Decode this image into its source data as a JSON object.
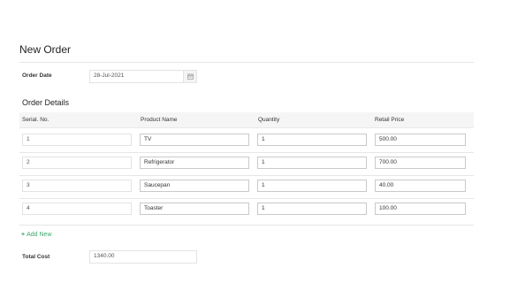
{
  "page": {
    "title": "New Order"
  },
  "order_date": {
    "label": "Order Date",
    "value": "28-Jul-2021"
  },
  "order_details": {
    "title": "Order Details",
    "columns": [
      "Serial. No.",
      "Product Name",
      "Quantity",
      "Retail Price"
    ],
    "rows": [
      {
        "serial": "1",
        "product": "TV",
        "quantity": "1",
        "price": "500.00"
      },
      {
        "serial": "2",
        "product": "Refrigerator",
        "quantity": "1",
        "price": "700.00"
      },
      {
        "serial": "3",
        "product": "Saucepan",
        "quantity": "1",
        "price": "40.00"
      },
      {
        "serial": "4",
        "product": "Toaster",
        "quantity": "1",
        "price": "100.00"
      }
    ]
  },
  "add_new": {
    "label": "Add New"
  },
  "total_cost": {
    "label": "Total Cost",
    "value": "1340.00"
  },
  "colors": {
    "accent": "#3fa66b"
  }
}
